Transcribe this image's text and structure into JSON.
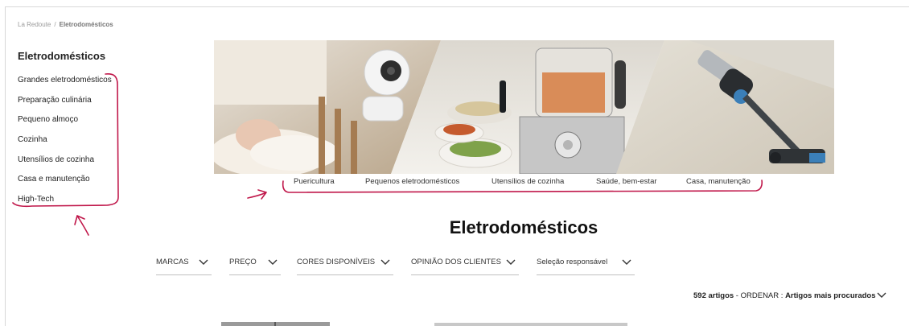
{
  "breadcrumb": {
    "root": "La Redoute",
    "separator": "/",
    "current": "Eletrodomésticos"
  },
  "sidebar": {
    "title": "Eletrodomésticos",
    "items": [
      {
        "label": "Grandes eletrodomésticos"
      },
      {
        "label": "Preparação culinária"
      },
      {
        "label": "Pequeno almoço"
      },
      {
        "label": "Cozinha"
      },
      {
        "label": "Utensílios de cozinha"
      },
      {
        "label": "Casa e manutenção"
      },
      {
        "label": "High-Tech"
      }
    ]
  },
  "hero": {
    "panels": [
      "baby-monitor-photo",
      "food-processor-photo",
      "stick-vacuum-photo"
    ]
  },
  "category_links": [
    {
      "label": "Puericultura"
    },
    {
      "label": "Pequenos eletrodomésticos"
    },
    {
      "label": "Utensílios de cozinha"
    },
    {
      "label": "Saúde, bem-estar"
    },
    {
      "label": "Casa, manutenção"
    }
  ],
  "page_title": "Eletrodomésticos",
  "filters": [
    {
      "label": "MARCAS"
    },
    {
      "label": "PREÇO"
    },
    {
      "label": "CORES DISPONÍVEIS"
    },
    {
      "label": "OPINIÃO DOS CLIENTES"
    },
    {
      "label": "Seleção responsável"
    }
  ],
  "results": {
    "count": "592 artigos",
    "separator": " - ",
    "sort_prefix": "ORDENAR : ",
    "sort_value": "Artigos mais procurados"
  },
  "annotation_color": "#c0174a"
}
